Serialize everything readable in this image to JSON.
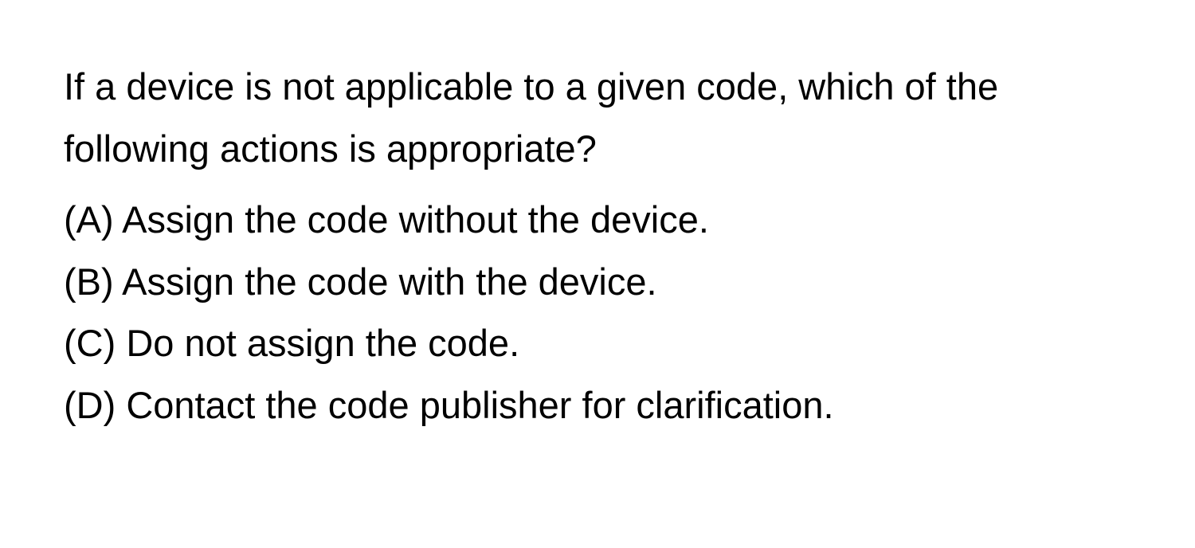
{
  "question": "If a device is not applicable to a given code, which of the following actions is appropriate?",
  "options": [
    {
      "label": "(A)",
      "text": "Assign the code without the device."
    },
    {
      "label": "(B)",
      "text": "Assign the code with the device."
    },
    {
      "label": "(C)",
      "text": "Do not assign the code."
    },
    {
      "label": "(D)",
      "text": "Contact the code publisher for clarification."
    }
  ]
}
